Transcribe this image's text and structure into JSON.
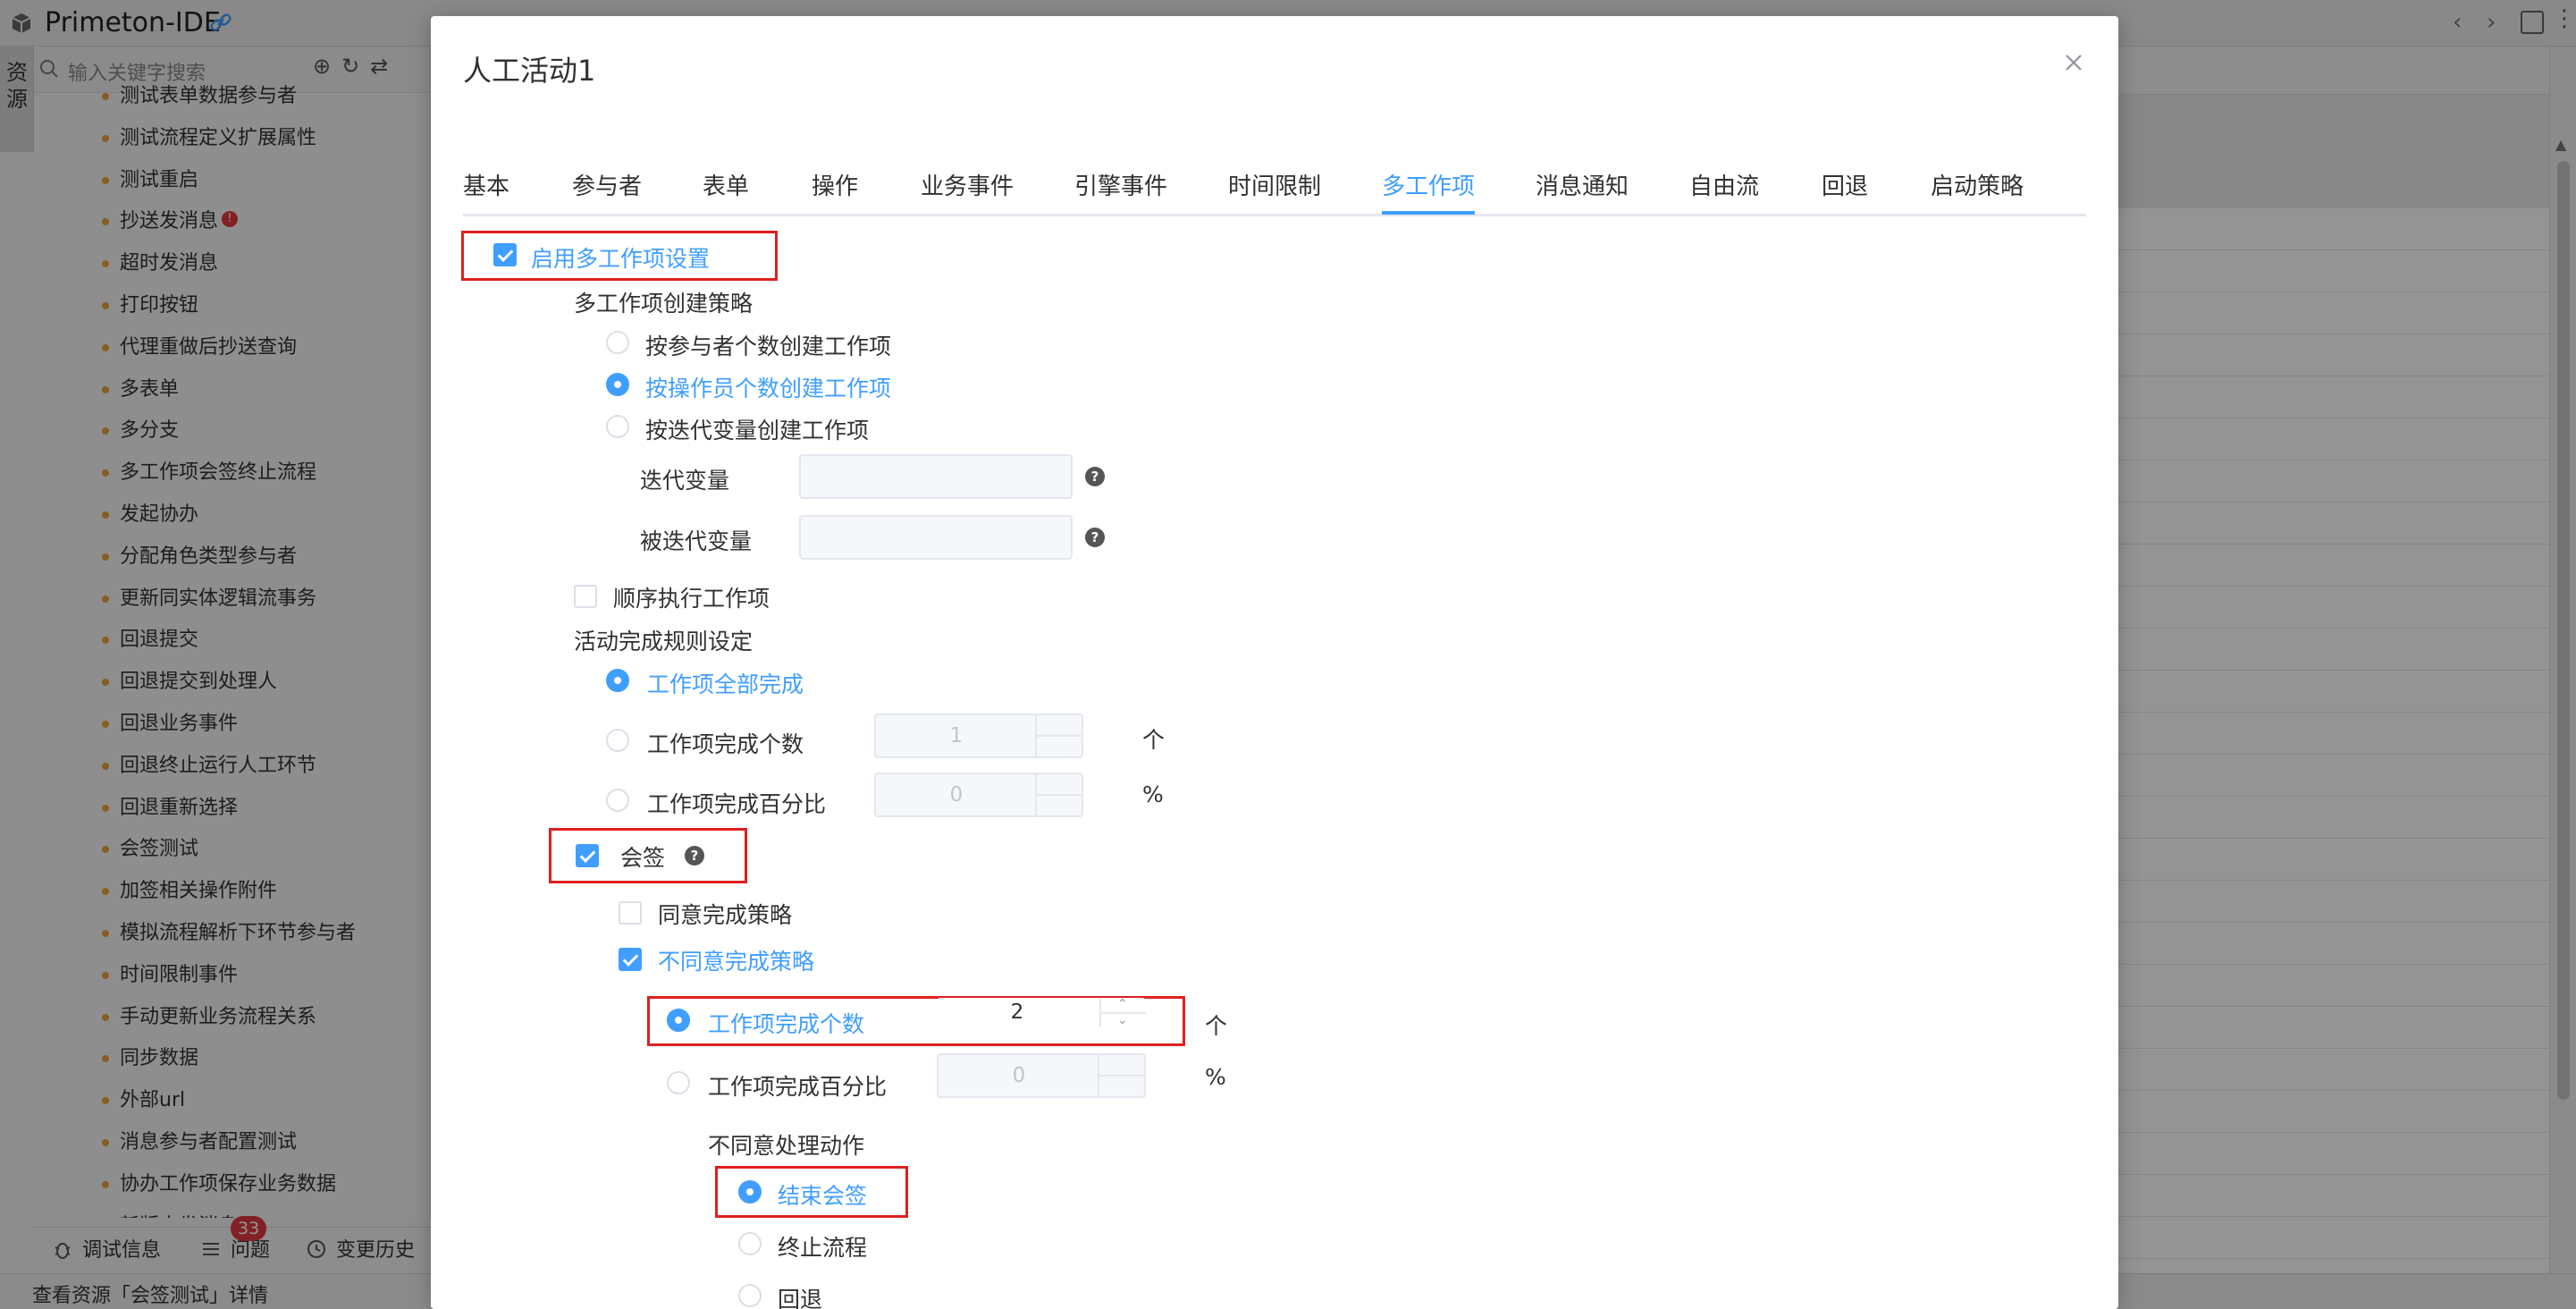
{
  "ide": {
    "app_title": "Primeton-IDE",
    "side_tab_label": "资源",
    "search_placeholder": "输入关键字搜索",
    "toolbar_icons": "⊕↻⇄",
    "tree_items": [
      "测试表单数据参与者",
      "测试流程定义扩展属性",
      "测试重启",
      "抄送发消息",
      "超时发消息",
      "打印按钮",
      "代理重做后抄送查询",
      "多表单",
      "多分支",
      "多工作项会签终止流程",
      "发起协办",
      "分配角色类型参与者",
      "更新同实体逻辑流事务",
      "回退提交",
      "回退提交到处理人",
      "回退业务事件",
      "回退终止运行人工环节",
      "回退重新选择",
      "会签测试",
      "加签相关操作附件",
      "模拟流程解析下环节参与者",
      "时间限制事件",
      "手动更新业务流程关系",
      "同步数据",
      "外部url",
      "消息参与者配置测试",
      "协办工作项保存业务数据",
      "新版本发消息"
    ],
    "tree_error_mark": "!",
    "bottom_tabs": {
      "debug": "调试信息",
      "problems": "问题",
      "history": "变更历史"
    },
    "problems_badge": "33",
    "status_text": "查看资源「会签测试」详情"
  },
  "dialog": {
    "title": "人工活动1",
    "tabs": [
      "基本",
      "参与者",
      "表单",
      "操作",
      "业务事件",
      "引擎事件",
      "时间限制",
      "多工作项",
      "消息通知",
      "自由流",
      "回退",
      "启动策略"
    ],
    "active_tab": "多工作项",
    "enable_multi": {
      "label": "启用多工作项设置",
      "checked": true
    },
    "create_strategy": {
      "heading": "多工作项创建策略",
      "options": [
        {
          "label": "按参与者个数创建工作项",
          "checked": false
        },
        {
          "label": "按操作员个数创建工作项",
          "checked": true
        },
        {
          "label": "按迭代变量创建工作项",
          "checked": false
        }
      ],
      "iter_var_label": "迭代变量",
      "iterated_var_label": "被迭代变量",
      "iter_var_value": "",
      "iterated_var_value": "",
      "help_glyph": "?"
    },
    "sequential": {
      "label": "顺序执行工作项",
      "checked": false
    },
    "completion": {
      "heading": "活动完成规则设定",
      "options": [
        {
          "label": "工作项全部完成",
          "checked": true
        },
        {
          "label": "工作项完成个数",
          "checked": false
        },
        {
          "label": "工作项完成百分比",
          "checked": false
        }
      ],
      "count_value": "1",
      "count_unit": "个",
      "percent_value": "0",
      "percent_unit": "%"
    },
    "countersign": {
      "label": "会签",
      "checked": true,
      "agree_strategy": {
        "label": "同意完成策略",
        "checked": false
      },
      "disagree_strategy": {
        "label": "不同意完成策略",
        "checked": true
      },
      "disagree_options": [
        {
          "label": "工作项完成个数",
          "checked": true
        },
        {
          "label": "工作项完成百分比",
          "checked": false
        }
      ],
      "disagree_count_value": "2",
      "disagree_count_unit": "个",
      "disagree_percent_value": "0",
      "disagree_percent_unit": "%",
      "action_heading": "不同意处理动作",
      "actions": [
        {
          "label": "结束会签",
          "checked": true
        },
        {
          "label": "终止流程",
          "checked": false
        },
        {
          "label": "回退",
          "checked": false
        }
      ]
    }
  },
  "colors": {
    "accent": "#409eff",
    "highlight_box": "#e02020",
    "badge": "#e0393e"
  }
}
